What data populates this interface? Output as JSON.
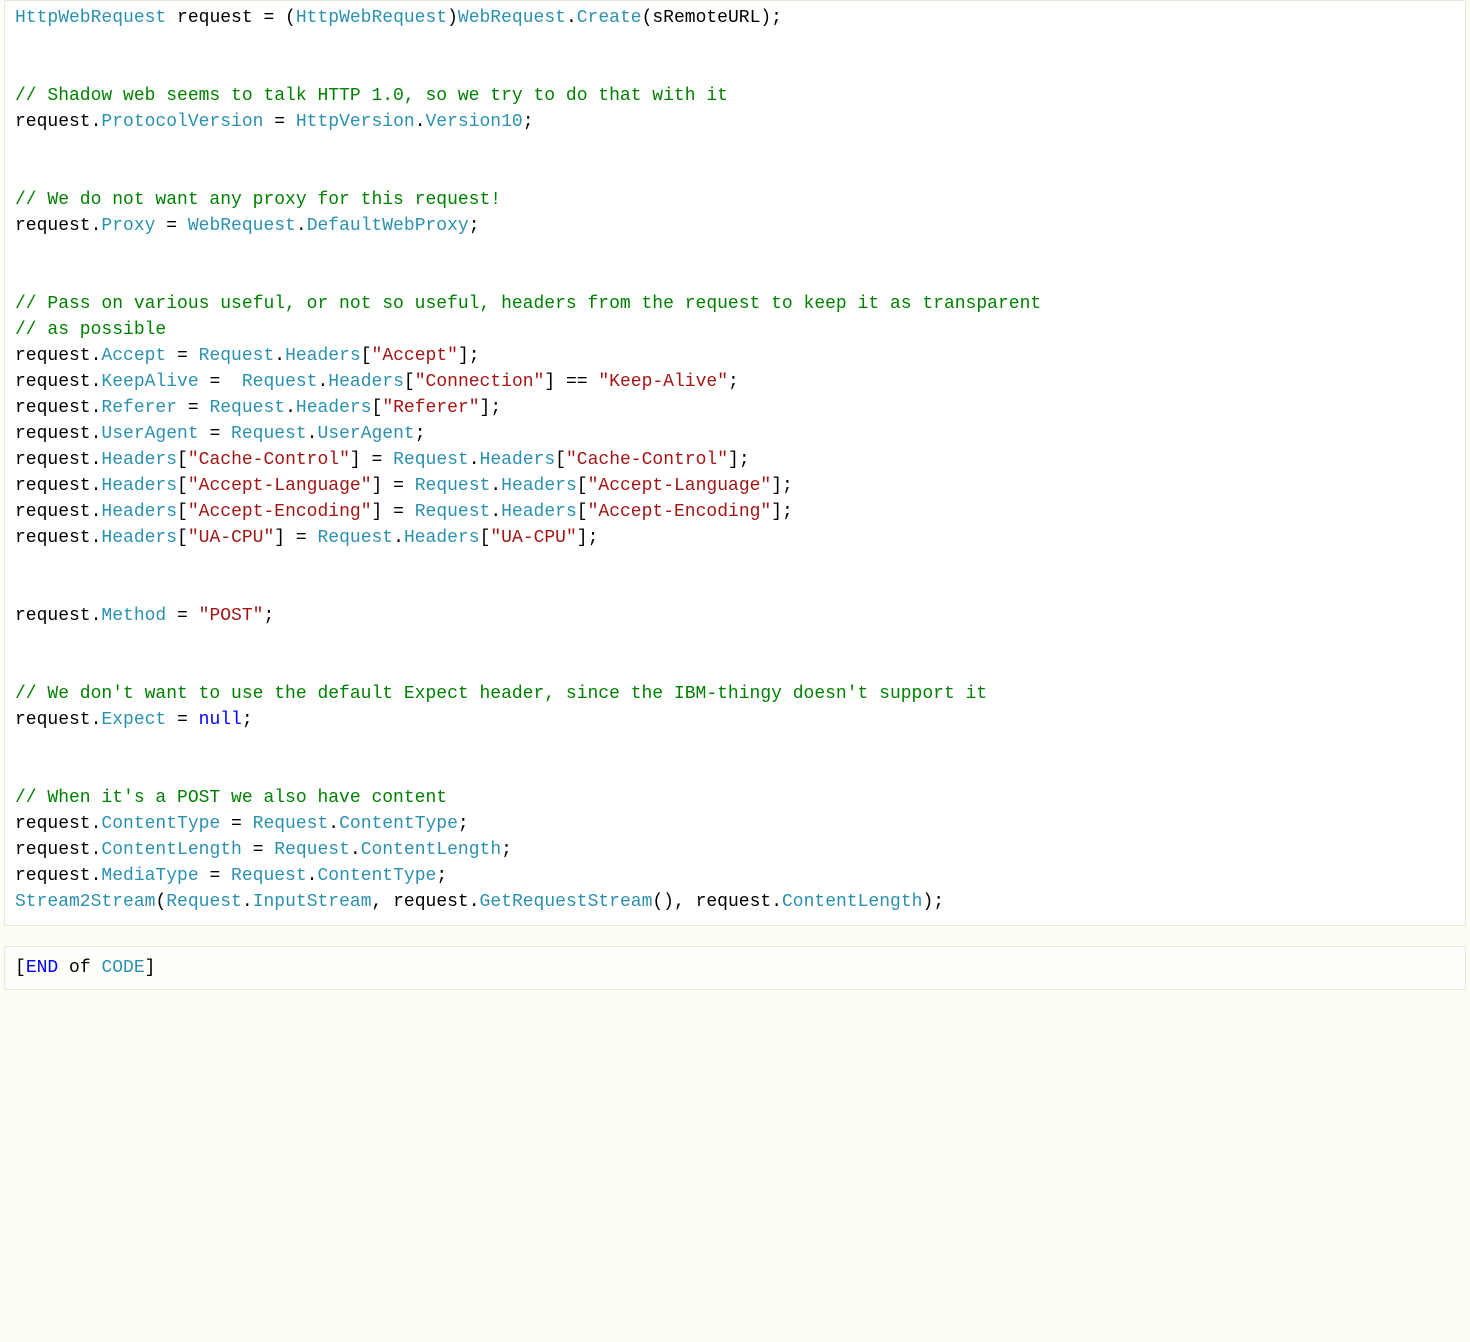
{
  "code1": {
    "l1": {
      "a": "HttpWebRequest",
      "b": " request = (",
      "c": "HttpWebRequest",
      "d": ")",
      "e": "WebRequest",
      "f": ".",
      "g": "Create",
      "h": "(sRemoteURL);"
    },
    "c2": "// Shadow web seems to talk HTTP 1.0, so we try to do that with it",
    "l3": {
      "a": "request.",
      "b": "ProtocolVersion",
      "c": " = ",
      "d": "HttpVersion",
      "e": ".",
      "f": "Version10",
      "g": ";"
    },
    "c4": "// We do not want any proxy for this request!",
    "l5": {
      "a": "request.",
      "b": "Proxy",
      "c": " = ",
      "d": "WebRequest",
      "e": ".",
      "f": "DefaultWebProxy",
      "g": ";"
    },
    "c6": "// Pass on various useful, or not so useful, headers from the request to keep it as transparent",
    "c7": "// as possible",
    "l8": {
      "a": "request.",
      "b": "Accept",
      "c": " = ",
      "d": "Request",
      "e": ".",
      "f": "Headers",
      "g": "[",
      "h": "\"Accept\"",
      "i": "];"
    },
    "l9": {
      "a": "request.",
      "b": "KeepAlive",
      "c": " =  ",
      "d": "Request",
      "e": ".",
      "f": "Headers",
      "g": "[",
      "h": "\"Connection\"",
      "i": "] == ",
      "j": "\"Keep-Alive\"",
      "k": ";"
    },
    "l10": {
      "a": "request.",
      "b": "Referer",
      "c": " = ",
      "d": "Request",
      "e": ".",
      "f": "Headers",
      "g": "[",
      "h": "\"Referer\"",
      "i": "];"
    },
    "l11": {
      "a": "request.",
      "b": "UserAgent",
      "c": " = ",
      "d": "Request",
      "e": ".",
      "f": "UserAgent",
      "g": ";"
    },
    "l12": {
      "a": "request.",
      "b": "Headers",
      "c": "[",
      "d": "\"Cache-Control\"",
      "e": "] = ",
      "f": "Request",
      "g": ".",
      "h": "Headers",
      "i": "[",
      "j": "\"Cache-Control\"",
      "k": "];"
    },
    "l13": {
      "a": "request.",
      "b": "Headers",
      "c": "[",
      "d": "\"Accept-Language\"",
      "e": "] = ",
      "f": "Request",
      "g": ".",
      "h": "Headers",
      "i": "[",
      "j": "\"Accept-Language\"",
      "k": "];"
    },
    "l14": {
      "a": "request.",
      "b": "Headers",
      "c": "[",
      "d": "\"Accept-Encoding\"",
      "e": "] = ",
      "f": "Request",
      "g": ".",
      "h": "Headers",
      "i": "[",
      "j": "\"Accept-Encoding\"",
      "k": "];"
    },
    "l15": {
      "a": "request.",
      "b": "Headers",
      "c": "[",
      "d": "\"UA-CPU\"",
      "e": "] = ",
      "f": "Request",
      "g": ".",
      "h": "Headers",
      "i": "[",
      "j": "\"UA-CPU\"",
      "k": "];"
    },
    "l16": {
      "a": "request.",
      "b": "Method",
      "c": " = ",
      "d": "\"POST\"",
      "e": ";"
    },
    "c17": "// We don't want to use the default Expect header, since the IBM-thingy doesn't support it",
    "l18": {
      "a": "request.",
      "b": "Expect",
      "c": " = ",
      "d": "null",
      "e": ";"
    },
    "c19": "// When it's a POST we also have content",
    "l20": {
      "a": "request.",
      "b": "ContentType",
      "c": " = ",
      "d": "Request",
      "e": ".",
      "f": "ContentType",
      "g": ";"
    },
    "l21": {
      "a": "request.",
      "b": "ContentLength",
      "c": " = ",
      "d": "Request",
      "e": ".",
      "f": "ContentLength",
      "g": ";"
    },
    "l22": {
      "a": "request.",
      "b": "MediaType",
      "c": " = ",
      "d": "Request",
      "e": ".",
      "f": "ContentType",
      "g": ";"
    },
    "l23": {
      "a": "Stream2Stream",
      "b": "(",
      "c": "Request",
      "d": ".",
      "e": "InputStream",
      "f": ", request.",
      "g": "GetRequestStream",
      "h": "(), request.",
      "i": "ContentLength",
      "j": ");"
    }
  },
  "code2": {
    "a": "[",
    "b": "END",
    "c": " of ",
    "d": "CODE",
    "e": "]"
  }
}
